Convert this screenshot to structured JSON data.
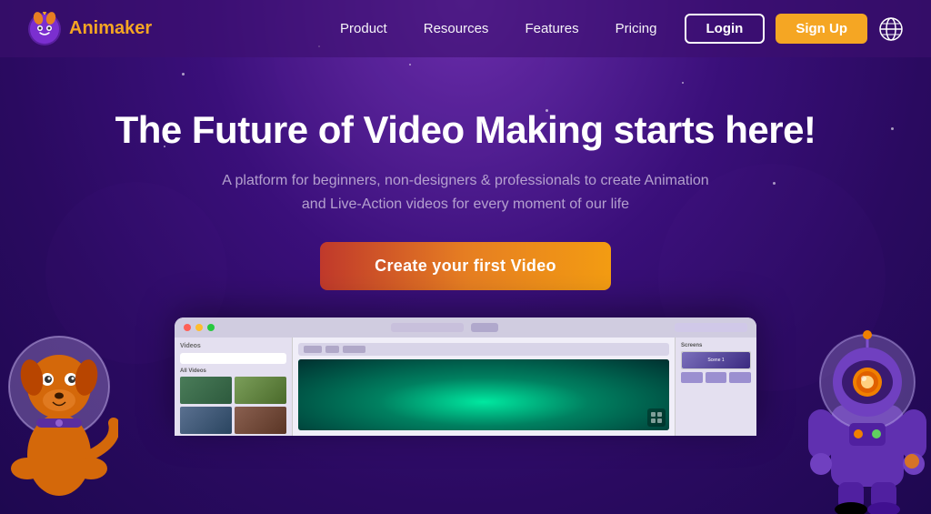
{
  "brand": {
    "name": "Animaker",
    "logo_alt": "Animaker logo"
  },
  "nav": {
    "links": [
      {
        "label": "Product",
        "id": "product"
      },
      {
        "label": "Resources",
        "id": "resources"
      },
      {
        "label": "Features",
        "id": "features"
      },
      {
        "label": "Pricing",
        "id": "pricing"
      }
    ],
    "login_label": "Login",
    "signup_label": "Sign Up",
    "globe_aria": "Language selector"
  },
  "hero": {
    "title": "The Future of Video Making starts here!",
    "subtitle": "A platform for beginners, non-designers & professionals to create Animation and Live-Action videos for every moment of our life",
    "cta_label": "Create your first Video"
  },
  "colors": {
    "orange": "#f5a623",
    "cta_start": "#c0392b",
    "cta_end": "#f39c12",
    "bg_deep": "#2a0a60",
    "bg_mid": "#4a1a8c"
  }
}
